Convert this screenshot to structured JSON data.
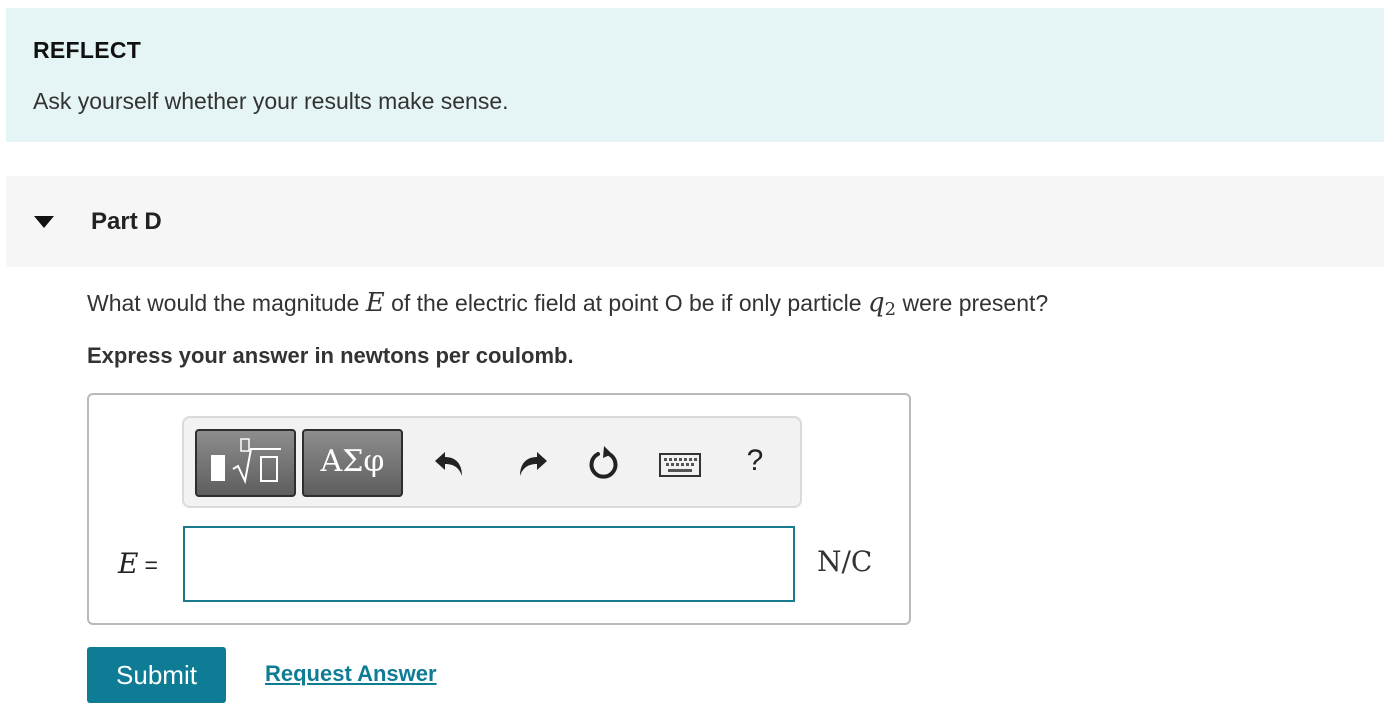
{
  "reflect": {
    "title": "REFLECT",
    "text": "Ask yourself whether your results make sense."
  },
  "part": {
    "title": "Part D",
    "expanded": true
  },
  "question": {
    "before": "What would the magnitude ",
    "var_e": "E",
    "middle": " of the electric field at point O be if only particle ",
    "var_q": "q",
    "var_q_sub": "2",
    "after": " were present?"
  },
  "instruction": "Express your answer in newtons per coulomb.",
  "toolbar": {
    "templates_icon": "templates-radical-icon",
    "greek_label": "ΑΣφ",
    "undo_icon": "undo-icon",
    "redo_icon": "redo-icon",
    "reset_icon": "reset-icon",
    "keyboard_icon": "keyboard-icon",
    "help_label": "?"
  },
  "answer": {
    "variable": "E",
    "equals": "=",
    "value": "",
    "unit": "N/C"
  },
  "actions": {
    "submit_label": "Submit",
    "request_answer_label": "Request Answer"
  },
  "colors": {
    "reflect_bg": "#e5f5f6",
    "part_header_bg": "#f6f6f6",
    "accent": "#0e7c95",
    "input_border": "#1a7a90"
  }
}
